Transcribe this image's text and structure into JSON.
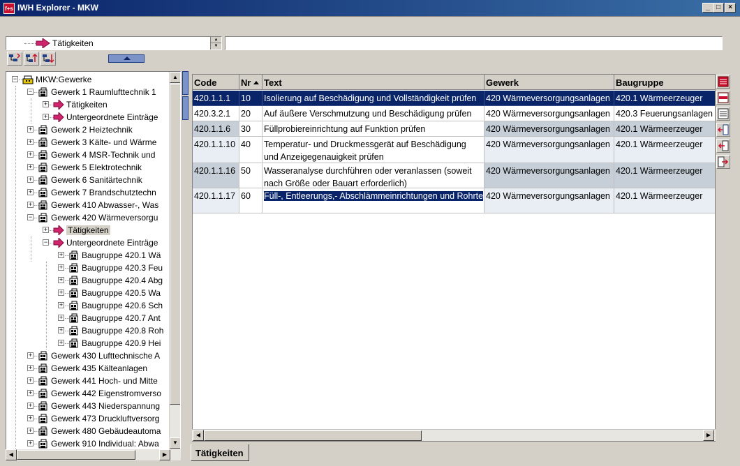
{
  "window": {
    "app_icon": "f+s",
    "title": "IWH Explorer - MKW",
    "minimize": "_",
    "maximize": "□",
    "close": "×"
  },
  "toolbar": {
    "combo_value": "Tätigkeiten",
    "text_value": "",
    "buttons": [
      "refresh-tree-icon",
      "tree-up-icon",
      "tree-down-icon"
    ]
  },
  "tree": {
    "root": "MKW:Gewerke",
    "nodes": [
      {
        "label": "Gewerk 1 Raumlufttechnik 1",
        "level": 1,
        "expander": "−",
        "icon": "building-icon"
      },
      {
        "label": "Tätigkeiten",
        "level": 2,
        "expander": "+",
        "icon": "arrow-icon"
      },
      {
        "label": "Untergeordnete Einträge",
        "level": 2,
        "expander": "+",
        "icon": "arrow-icon"
      },
      {
        "label": "Gewerk 2 Heiztechnik",
        "level": 1,
        "expander": "+",
        "icon": "building-icon"
      },
      {
        "label": "Gewerk 3 Kälte- und Wärme",
        "level": 1,
        "expander": "+",
        "icon": "building-icon"
      },
      {
        "label": "Gewerk 4 MSR-Technik und",
        "level": 1,
        "expander": "+",
        "icon": "building-icon"
      },
      {
        "label": "Gewerk 5 Elektrotechnik",
        "level": 1,
        "expander": "+",
        "icon": "building-icon"
      },
      {
        "label": "Gewerk 6 Sanitärtechnik",
        "level": 1,
        "expander": "+",
        "icon": "building-icon"
      },
      {
        "label": "Gewerk 7 Brandschutztechn",
        "level": 1,
        "expander": "+",
        "icon": "building-icon"
      },
      {
        "label": "Gewerk 410 Abwasser-, Was",
        "level": 1,
        "expander": "+",
        "icon": "building-icon"
      },
      {
        "label": "Gewerk 420 Wärmeversorgu",
        "level": 1,
        "expander": "−",
        "icon": "building-icon"
      },
      {
        "label": "Tätigkeiten",
        "level": 2,
        "expander": "+",
        "icon": "arrow-icon",
        "selected": true
      },
      {
        "label": "Untergeordnete Einträge",
        "level": 2,
        "expander": "−",
        "icon": "arrow-icon"
      },
      {
        "label": "Baugruppe 420.1 Wä",
        "level": 3,
        "expander": "+",
        "icon": "building-icon"
      },
      {
        "label": "Baugruppe 420.3 Feu",
        "level": 3,
        "expander": "+",
        "icon": "building-icon"
      },
      {
        "label": "Baugruppe 420.4 Abg",
        "level": 3,
        "expander": "+",
        "icon": "building-icon"
      },
      {
        "label": "Baugruppe 420.5 Wa",
        "level": 3,
        "expander": "+",
        "icon": "building-icon"
      },
      {
        "label": "Baugruppe 420.6 Sch",
        "level": 3,
        "expander": "+",
        "icon": "building-icon"
      },
      {
        "label": "Baugruppe 420.7 Ant",
        "level": 3,
        "expander": "+",
        "icon": "building-icon"
      },
      {
        "label": "Baugruppe 420.8 Roh",
        "level": 3,
        "expander": "+",
        "icon": "building-icon"
      },
      {
        "label": "Baugruppe 420.9 Hei",
        "level": 3,
        "expander": "+",
        "icon": "building-icon"
      },
      {
        "label": "Gewerk 430 Lufttechnische A",
        "level": 1,
        "expander": "+",
        "icon": "building-icon"
      },
      {
        "label": "Gewerk 435 Kälteanlagen",
        "level": 1,
        "expander": "+",
        "icon": "building-icon"
      },
      {
        "label": "Gewerk 441 Hoch- und Mitte",
        "level": 1,
        "expander": "+",
        "icon": "building-icon"
      },
      {
        "label": "Gewerk 442 Eigenstromverso",
        "level": 1,
        "expander": "+",
        "icon": "building-icon"
      },
      {
        "label": "Gewerk 443 Niederspannung",
        "level": 1,
        "expander": "+",
        "icon": "building-icon"
      },
      {
        "label": "Gewerk 473 Druckluftversorg",
        "level": 1,
        "expander": "+",
        "icon": "building-icon"
      },
      {
        "label": "Gewerk 480 Gebäudeautoma",
        "level": 1,
        "expander": "+",
        "icon": "building-icon"
      },
      {
        "label": "Gewerk 910 Individual: Abwa",
        "level": 1,
        "expander": "+",
        "icon": "building-icon"
      }
    ]
  },
  "grid": {
    "columns": [
      "Code",
      "Nr",
      "Text",
      "Gewerk",
      "Baugruppe"
    ],
    "sort_column": "Nr",
    "rows": [
      {
        "code": "420.1.1.1",
        "nr": "10",
        "text": "Isolierung auf Beschädigung und Vollständigkeit prüfen",
        "gewerk": "420 Wärmeversorgungsanlagen",
        "baugruppe": "420.1 Wärmeerzeuger",
        "style": "selected"
      },
      {
        "code": "420.3.2.1",
        "nr": "20",
        "text": "Auf äußere Verschmutzung und Beschädigung prüfen",
        "gewerk": "420 Wärmeversorgungsanlagen",
        "baugruppe": "420.3 Feuerungsanlagen",
        "style": "plain"
      },
      {
        "code": "420.1.1.6",
        "nr": "30",
        "text": "Füllprobiereinrichtung auf Funktion prüfen",
        "gewerk": "420 Wärmeversorgungsanlagen",
        "baugruppe": "420.1 Wärmeerzeuger",
        "style": "grey"
      },
      {
        "code": "420.1.1.10",
        "nr": "40",
        "text": "Temperatur- und Druckmessgerät auf Beschädigung und Anzeigegenauigkeit prüfen",
        "gewerk": "420 Wärmeversorgungsanlagen",
        "baugruppe": "420.1 Wärmeerzeuger",
        "style": "light"
      },
      {
        "code": "420.1.1.16",
        "nr": "50",
        "text": "Wasseranalyse durchführen oder veranlassen (soweit nach Größe oder Bauart erforderlich)",
        "gewerk": "420 Wärmeversorgungsanlagen",
        "baugruppe": "420.1 Wärmeerzeuger",
        "style": "grey"
      },
      {
        "code": "420.1.1.17",
        "nr": "60",
        "text": "Füll-, Entleerungs,- Abschlämmeinrichtungen und Rohrte",
        "gewerk": "420 Wärmeversorgungsanlagen",
        "baugruppe": "420.1 Wärmeerzeuger",
        "style": "light"
      }
    ]
  },
  "side_buttons": [
    "insert-row-icon",
    "delete-row-icon",
    "list-icon",
    "move-left-icon",
    "import-icon",
    "export-icon"
  ],
  "tabs": [
    {
      "label": "Tätigkeiten"
    }
  ],
  "colors": {
    "selection": "#0a246a",
    "title_start": "#0a246a",
    "title_end": "#3a6ea5",
    "arrow_icon": "#d0246e"
  }
}
